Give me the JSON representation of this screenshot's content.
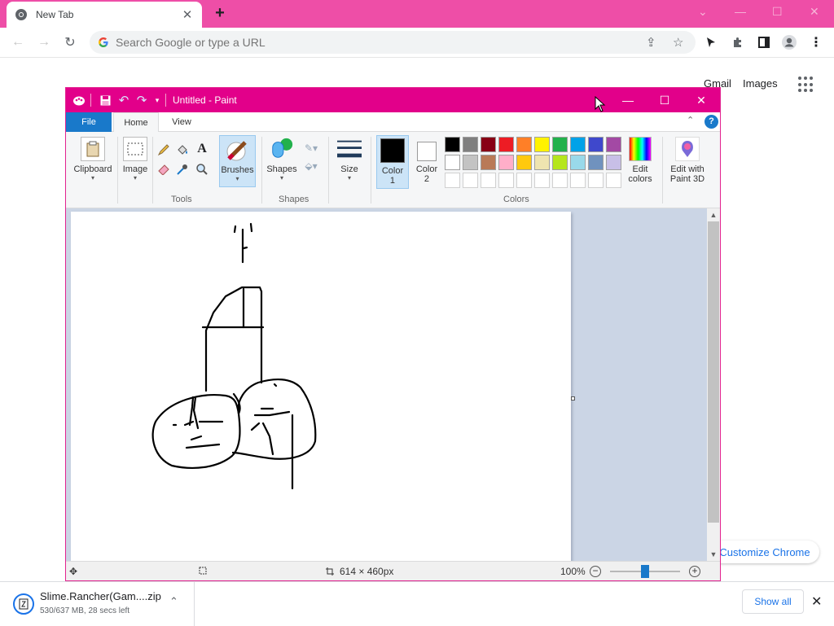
{
  "browser": {
    "tab_title": "New Tab",
    "omnibox_placeholder": "Search Google or type a URL",
    "accent": "#ee4ea7"
  },
  "ntp": {
    "gmail": "Gmail",
    "images": "Images",
    "customize": "Customize Chrome"
  },
  "download": {
    "filename": "Slime.Rancher(Gam....zip",
    "status": "530/637 MB, 28 secs left",
    "show_all": "Show all"
  },
  "paint": {
    "title": "Untitled - Paint",
    "titlebar_color": "#e2008a",
    "tabs": {
      "file": "File",
      "home": "Home",
      "view": "View"
    },
    "ribbon": {
      "clipboard": "Clipboard",
      "image": "Image",
      "tools_group": "Tools",
      "brushes": "Brushes",
      "shapes": "Shapes",
      "shapes_group": "Shapes",
      "size": "Size",
      "color1_a": "Color",
      "color1_b": "1",
      "color2_a": "Color",
      "color2_b": "2",
      "edit_colors_a": "Edit",
      "edit_colors_b": "colors",
      "paint3d_a": "Edit with",
      "paint3d_b": "Paint 3D",
      "colors_group": "Colors"
    },
    "palette_row1": [
      "#000000",
      "#7f7f7f",
      "#880015",
      "#ed1c24",
      "#ff7f27",
      "#fff200",
      "#22b14c",
      "#00a2e8",
      "#3f48cc",
      "#a349a4"
    ],
    "palette_row2": [
      "#ffffff",
      "#c3c3c3",
      "#b97a57",
      "#ffaec9",
      "#ffc90e",
      "#efe4b0",
      "#b5e61d",
      "#99d9ea",
      "#7092be",
      "#c8bfe7"
    ],
    "status": {
      "canvas_size": "614 × 460px",
      "zoom": "100%"
    }
  }
}
